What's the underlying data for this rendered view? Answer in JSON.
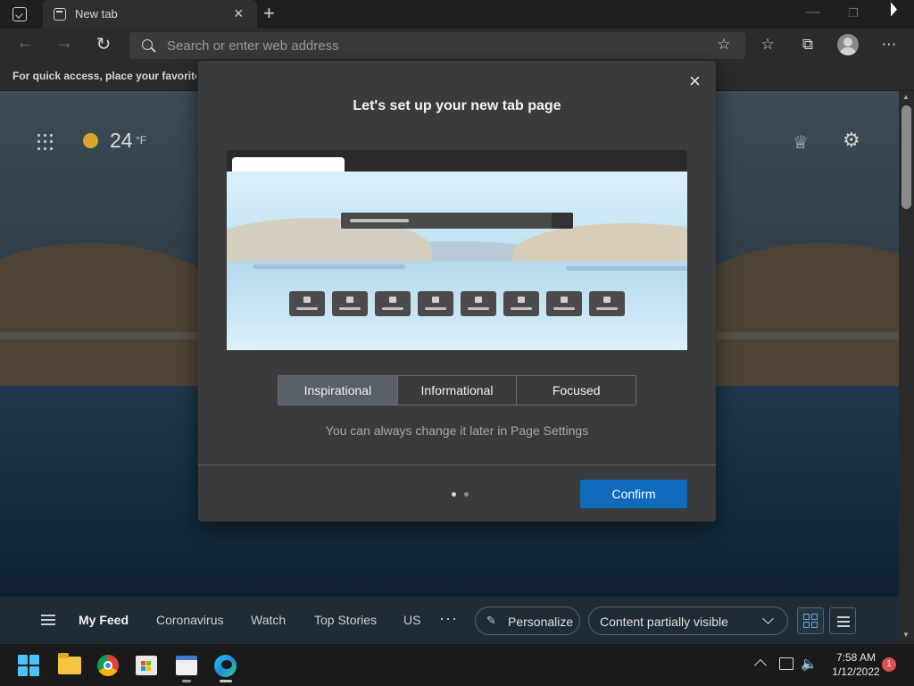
{
  "browser": {
    "tab_title": "New tab",
    "tab_close": "×",
    "new_tab": "+",
    "address_placeholder": "Search or enter web address",
    "favorites_hint": "For quick access, place your favorites here",
    "back": "←",
    "forward": "→",
    "refresh": "↻",
    "more": "⋯"
  },
  "newtab": {
    "temperature": "24",
    "temperature_unit": "°F"
  },
  "dialog": {
    "title": "Let's set up your new tab page",
    "close": "×",
    "options": [
      {
        "label": "Inspirational",
        "selected": true
      },
      {
        "label": "Informational",
        "selected": false
      },
      {
        "label": "Focused",
        "selected": false
      }
    ],
    "hint": "You can always change it later in Page Settings",
    "confirm_label": "Confirm",
    "page_dots": {
      "total": 2,
      "current": 1
    }
  },
  "feed": {
    "items": [
      "My Feed",
      "Coronavirus",
      "Watch",
      "Top Stories",
      "US"
    ],
    "active": "My Feed",
    "more": "···",
    "personalize_label": "Personalize",
    "content_visibility": "Content partially visible"
  },
  "taskbar": {
    "time": "7:58 AM",
    "date": "1/12/2022",
    "notification_count": "1"
  },
  "colors": {
    "accent": "#0f6cbd",
    "selected_segment": "#5a6068",
    "dialog_bg": "#3b3b3b"
  }
}
